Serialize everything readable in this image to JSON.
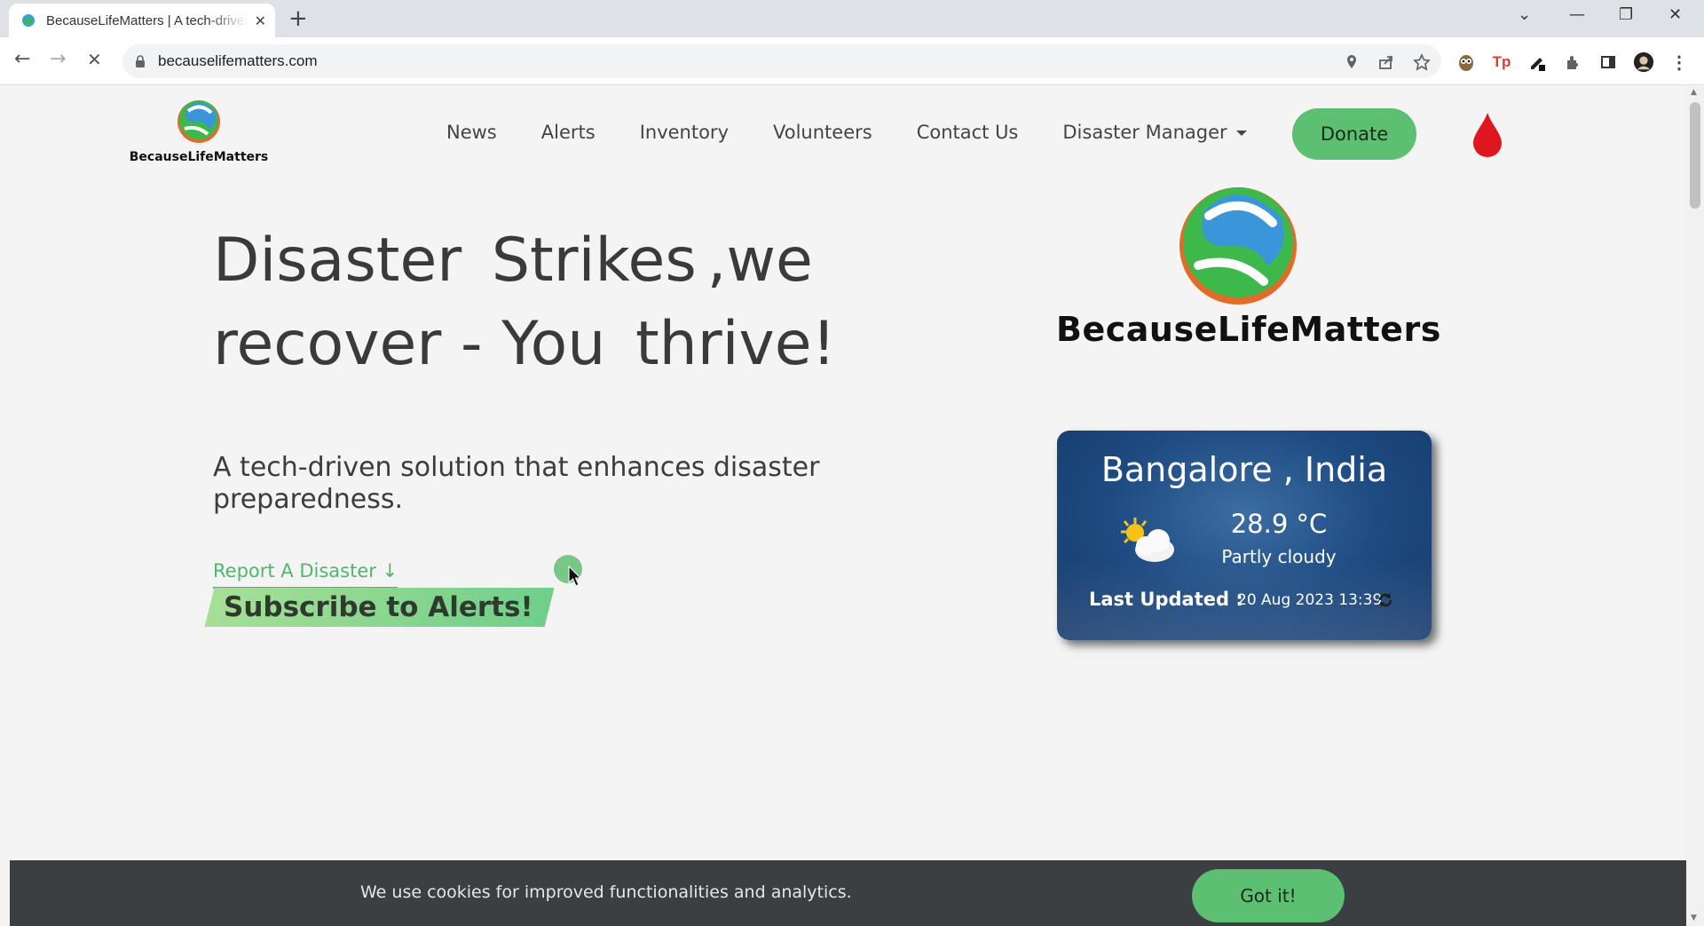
{
  "browser": {
    "tab_title": "BecauseLifeMatters | A tech-driven solution that enhances disaster preparedness",
    "tab_close": "✕",
    "new_tab": "+",
    "url": "becauselifematters.com",
    "back": "←",
    "forward": "→",
    "reload": "✕",
    "window_controls": {
      "dropdown": "⌄",
      "minimize": "—",
      "restore": "❐",
      "close": "✕"
    }
  },
  "site": {
    "brand": "BecauseLifeMatters",
    "nav": [
      {
        "label": "News"
      },
      {
        "label": "Alerts"
      },
      {
        "label": "Inventory"
      },
      {
        "label": "Volunteers"
      },
      {
        "label": "Contact Us"
      },
      {
        "label": "Disaster Manager"
      }
    ],
    "donate_label": "Donate"
  },
  "hero": {
    "line1_a": "Disaster",
    "line1_hl": "Strikes",
    "line1_b": ",we",
    "line2_a": "recover - You",
    "line2_hl": "thrive!",
    "subtitle": "A tech-driven solution that enhances disaster preparedness.",
    "report_link": "Report A Disaster ↓"
  },
  "weather": {
    "location": "Bangalore , India",
    "temperature": "28.9 °C",
    "condition": "Partly cloudy",
    "last_updated_label": "Last Updated :",
    "last_updated_value": "20 Aug 2023 13:39"
  },
  "subscribe": {
    "heading": "Subscribe to Alerts!"
  },
  "cookie": {
    "message": "We use cookies for improved functionalities and analytics.",
    "button": "Got it!"
  },
  "colors": {
    "accent_green": "#5cbf72",
    "link_green": "#4cb86a",
    "weather_blue": "#1e4b82",
    "banner_dark": "#3c3f42",
    "blood_red": "#e0161e"
  },
  "icons": [
    "globe-logo-icon",
    "blood-drop-icon",
    "partly-cloudy-icon",
    "refresh-icon",
    "lock-icon",
    "location-icon",
    "share-icon",
    "star-icon",
    "extensions-icon",
    "profile-avatar-icon"
  ]
}
